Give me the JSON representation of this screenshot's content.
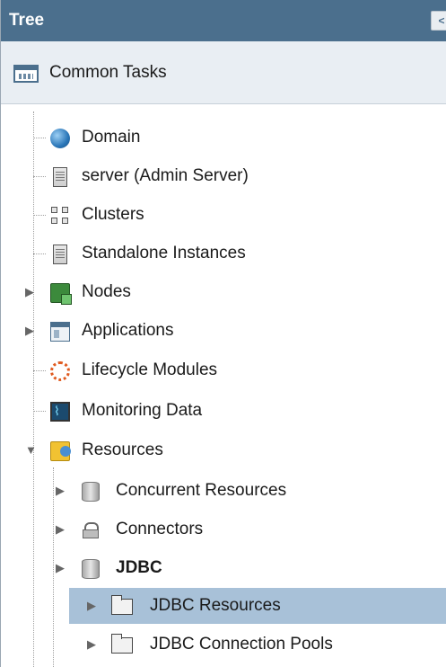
{
  "header": {
    "title": "Tree",
    "collapse_glyph": "<"
  },
  "tasks": {
    "label": "Common Tasks",
    "icon": "common-tasks-icon"
  },
  "tree": {
    "items": [
      {
        "label": "Domain",
        "icon": "domain-icon"
      },
      {
        "label": "server (Admin Server)",
        "icon": "server-icon"
      },
      {
        "label": "Clusters",
        "icon": "clusters-icon"
      },
      {
        "label": "Standalone Instances",
        "icon": "server-icon"
      },
      {
        "label": "Nodes",
        "icon": "nodes-icon",
        "expander": "▶"
      },
      {
        "label": "Applications",
        "icon": "applications-icon",
        "expander": "▶"
      },
      {
        "label": "Lifecycle Modules",
        "icon": "lifecycle-icon"
      },
      {
        "label": "Monitoring Data",
        "icon": "monitoring-icon"
      },
      {
        "label": "Resources",
        "icon": "resources-icon",
        "expander": "▼"
      },
      {
        "label": "Concurrent Resources",
        "icon": "database-icon",
        "expander": "▶"
      },
      {
        "label": "Connectors",
        "icon": "connector-icon",
        "expander": "▶"
      },
      {
        "label": "JDBC",
        "icon": "database-icon",
        "expander": "▶"
      },
      {
        "label": "JDBC Resources",
        "icon": "folder-icon",
        "expander": "▶",
        "selected": true
      },
      {
        "label": "JDBC Connection Pools",
        "icon": "folder-icon",
        "expander": "▶"
      }
    ]
  },
  "colors": {
    "header_bg": "#4b6f8d",
    "selected_bg": "#a8c1d8",
    "tasks_bg": "#e9eef3"
  }
}
